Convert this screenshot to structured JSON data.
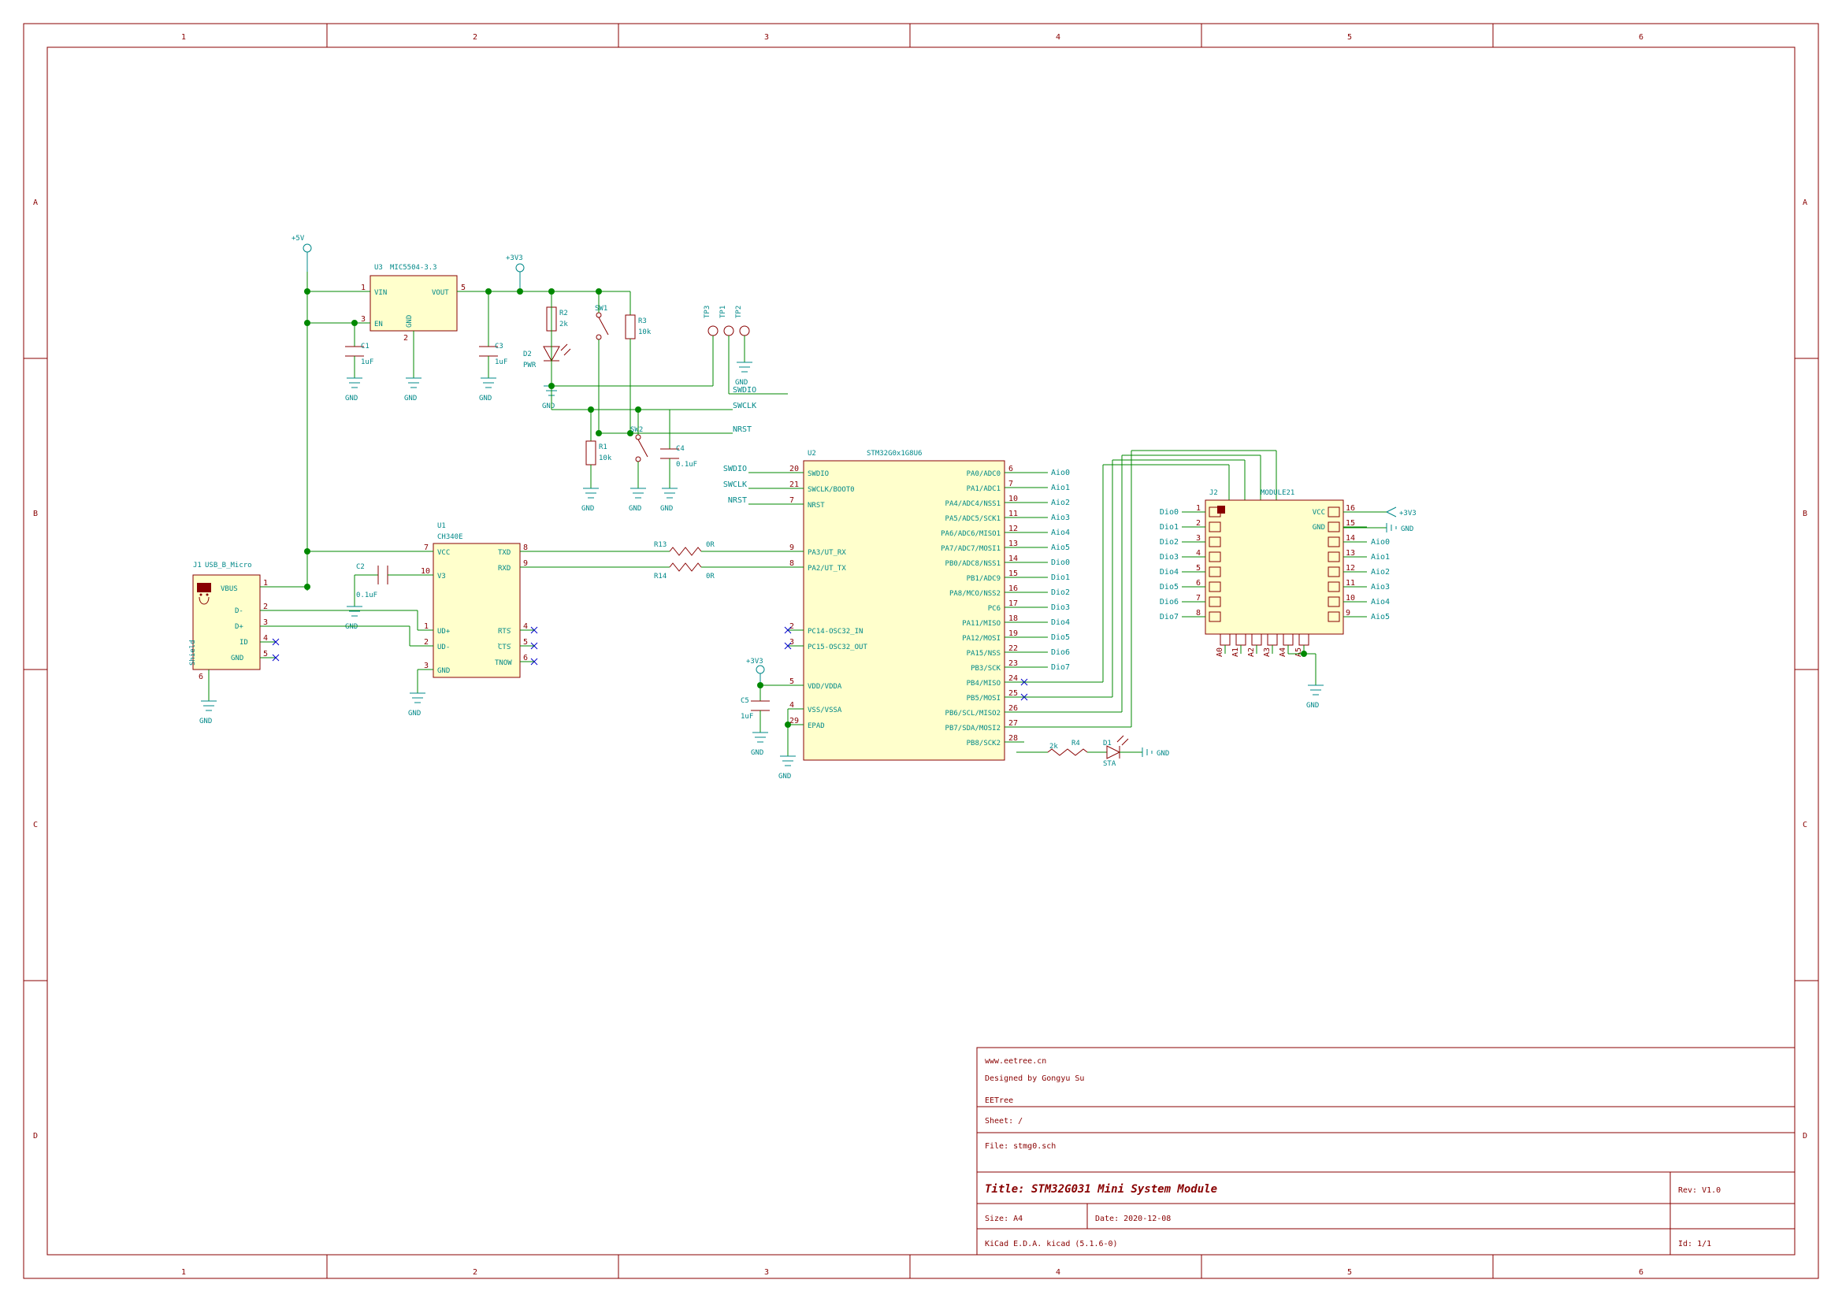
{
  "title_block": {
    "url": "www.eetree.cn",
    "designer": "Designed by Gongyu Su",
    "org": "EETree",
    "sheet": "Sheet: /",
    "file": "File: stmg0.sch",
    "title": "Title: STM32G031 Mini System Module",
    "size": "Size: A4",
    "date": "Date: 2020-12-08",
    "rev": "Rev: V1.0",
    "prog": "KiCad E.D.A.  kicad (5.1.6-0)",
    "id": "Id: 1/1"
  },
  "frame": {
    "cols": [
      "1",
      "2",
      "3",
      "4",
      "5",
      "6"
    ],
    "rows": [
      "A",
      "B",
      "C",
      "D"
    ]
  },
  "power": {
    "p5v": "+5V",
    "gnd": "GND",
    "p3v3": "+3V3"
  },
  "testpoints": [
    "TP1",
    "TP2",
    "TP3"
  ],
  "components": {
    "U3": {
      "ref": "U3",
      "val": "MIC5504-3.3",
      "pins": {
        "1": "VIN",
        "2": "GND",
        "3": "EN",
        "5": "VOUT"
      }
    },
    "U1": {
      "ref": "U1",
      "val": "CH340E",
      "pins": {
        "1": "UD+",
        "2": "UD-",
        "3": "GND",
        "4": "RTS",
        "5": "CTS",
        "6": "TNOW",
        "7": "VCC",
        "8": "TXD",
        "9": "RXD",
        "10": "V3"
      }
    },
    "U2": {
      "ref": "U2",
      "val": "STM32G0x1G8U6",
      "left": [
        {
          "n": "20",
          "name": "SWDIO",
          "lbl": "SWDIO"
        },
        {
          "n": "21",
          "name": "SWCLK/BOOT0",
          "lbl": "SWCLK"
        },
        {
          "n": "7",
          "name": "NRST",
          "lbl": "NRST"
        },
        {
          "n": "9",
          "name": "PA3/UT_RX"
        },
        {
          "n": "8",
          "name": "PA2/UT_TX"
        },
        {
          "n": "2",
          "name": "PC14-OSC32_IN"
        },
        {
          "n": "3",
          "name": "PC15-OSC32_OUT"
        },
        {
          "n": "5",
          "name": "VDD/VDDA"
        },
        {
          "n": "4",
          "name": "VSS/VSSA"
        },
        {
          "n": "29",
          "name": "EPAD"
        }
      ],
      "right": [
        {
          "n": "6",
          "name": "PA0/ADC0",
          "lbl": "Aio0"
        },
        {
          "n": "7",
          "name": "PA1/ADC1",
          "lbl": "Aio1"
        },
        {
          "n": "10",
          "name": "PA4/ADC4/NSS1",
          "lbl": "Aio2"
        },
        {
          "n": "11",
          "name": "PA5/ADC5/SCK1",
          "lbl": "Aio3"
        },
        {
          "n": "12",
          "name": "PA6/ADC6/MISO1",
          "lbl": "Aio4"
        },
        {
          "n": "13",
          "name": "PA7/ADC7/MOSI1",
          "lbl": "Aio5"
        },
        {
          "n": "14",
          "name": "PB0/ADC8/NSS1",
          "lbl": "Dio0"
        },
        {
          "n": "15",
          "name": "PB1/ADC9",
          "lbl": "Dio1"
        },
        {
          "n": "16",
          "name": "PA8/MCO/NSS2",
          "lbl": "Dio2"
        },
        {
          "n": "17",
          "name": "PC6",
          "lbl": "Dio3"
        },
        {
          "n": "18",
          "name": "PA11/MISO",
          "lbl": "Dio4"
        },
        {
          "n": "19",
          "name": "PA12/MOSI",
          "lbl": "Dio5"
        },
        {
          "n": "22",
          "name": "PA15/NSS",
          "lbl": "Dio6"
        },
        {
          "n": "23",
          "name": "PB3/SCK",
          "lbl": "Dio7"
        },
        {
          "n": "24",
          "name": "PB4/MISO"
        },
        {
          "n": "25",
          "name": "PB5/MOSI"
        },
        {
          "n": "26",
          "name": "PB6/SCL/MISO2"
        },
        {
          "n": "27",
          "name": "PB7/SDA/MOSI2"
        },
        {
          "n": "28",
          "name": "PB8/SCK2"
        }
      ]
    },
    "J1": {
      "ref": "J1",
      "val": "USB_B_Micro",
      "pins": {
        "1": "VBUS",
        "2": "D-",
        "3": "D+",
        "4": "ID",
        "5": "GND",
        "6": "Shield"
      }
    },
    "J2": {
      "ref": "J2",
      "val": "MODULE21",
      "left": [
        {
          "n": "1",
          "lbl": "Dio0"
        },
        {
          "n": "2",
          "lbl": "Dio1"
        },
        {
          "n": "3",
          "lbl": "Dio2"
        },
        {
          "n": "4",
          "lbl": "Dio3"
        },
        {
          "n": "5",
          "lbl": "Dio4"
        },
        {
          "n": "6",
          "lbl": "Dio5"
        },
        {
          "n": "7",
          "lbl": "Dio6"
        },
        {
          "n": "8",
          "lbl": "Dio7"
        }
      ],
      "right": [
        {
          "n": "16",
          "name": "VCC"
        },
        {
          "n": "15",
          "name": "GND"
        },
        {
          "n": "14",
          "lbl": "Aio0"
        },
        {
          "n": "13",
          "lbl": "Aio1"
        },
        {
          "n": "12",
          "lbl": "Aio2"
        },
        {
          "n": "11",
          "lbl": "Aio3"
        },
        {
          "n": "10",
          "lbl": "Aio4"
        },
        {
          "n": "9",
          "lbl": "Aio5"
        }
      ],
      "bottom": [
        {
          "n": "A0"
        },
        {
          "n": "A1"
        },
        {
          "n": "A2"
        },
        {
          "n": "A3"
        },
        {
          "n": "A4"
        },
        {
          "n": "A5"
        }
      ]
    },
    "C1": {
      "ref": "C1",
      "val": "1uF"
    },
    "C2": {
      "ref": "C2",
      "val": "0.1uF"
    },
    "C3": {
      "ref": "C3",
      "val": "1uF"
    },
    "C4": {
      "ref": "C4",
      "val": "0.1uF"
    },
    "C5": {
      "ref": "C5",
      "val": "1uF"
    },
    "R1": {
      "ref": "R1",
      "val": "10k"
    },
    "R2": {
      "ref": "R2",
      "val": "2k"
    },
    "R3": {
      "ref": "R3",
      "val": "10k"
    },
    "R4": {
      "ref": "R4",
      "val": "2k"
    },
    "R13": {
      "ref": "R13",
      "val": "0R"
    },
    "R14": {
      "ref": "R14",
      "val": "0R"
    },
    "D1": {
      "ref": "D1",
      "val": "STA"
    },
    "D2": {
      "ref": "D2",
      "val": "PWR"
    },
    "SW1": {
      "ref": "SW1"
    },
    "SW2": {
      "ref": "SW2"
    }
  }
}
